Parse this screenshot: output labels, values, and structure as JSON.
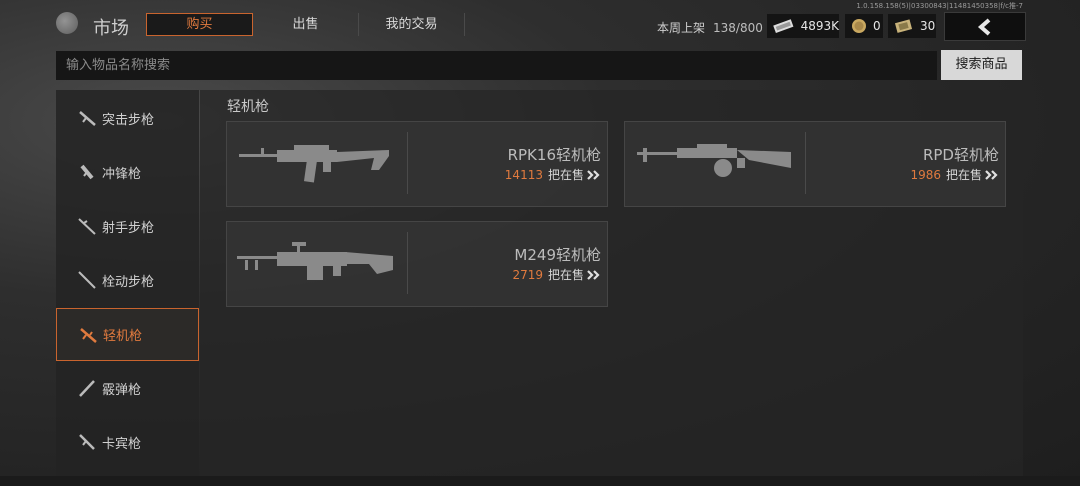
{
  "version": "1.0.158.158(5)|03300843|11481450358|f/c推-7",
  "header": {
    "title": "市场",
    "tabs": [
      {
        "label": "购买",
        "active": true
      },
      {
        "label": "出售",
        "active": false
      },
      {
        "label": "我的交易",
        "active": false
      }
    ],
    "weekly_label": "本周上架",
    "weekly_count": "138/800",
    "currencies": [
      {
        "icon": "cash-icon",
        "value": "4893K"
      },
      {
        "icon": "coin-icon",
        "value": "0"
      },
      {
        "icon": "ticket-icon",
        "value": "30"
      }
    ],
    "back_icon": "chevron-left-icon"
  },
  "search": {
    "placeholder": "输入物品名称搜索",
    "button_label": "搜索商品"
  },
  "sidebar": {
    "items": [
      {
        "label": "突击步枪",
        "active": false
      },
      {
        "label": "冲锋枪",
        "active": false
      },
      {
        "label": "射手步枪",
        "active": false
      },
      {
        "label": "栓动步枪",
        "active": false
      },
      {
        "label": "轻机枪",
        "active": true
      },
      {
        "label": "霰弹枪",
        "active": false
      },
      {
        "label": "卡宾枪",
        "active": false
      }
    ]
  },
  "main": {
    "section_title": "轻机枪",
    "cards": [
      {
        "name": "RPK16轻机枪",
        "count": "14113",
        "status": "把在售"
      },
      {
        "name": "RPD轻机枪",
        "count": "1986",
        "status": "把在售"
      },
      {
        "name": "M249轻机枪",
        "count": "2719",
        "status": "把在售"
      }
    ]
  },
  "colors": {
    "accent": "#e07a3e",
    "active_border": "#c9642e"
  }
}
